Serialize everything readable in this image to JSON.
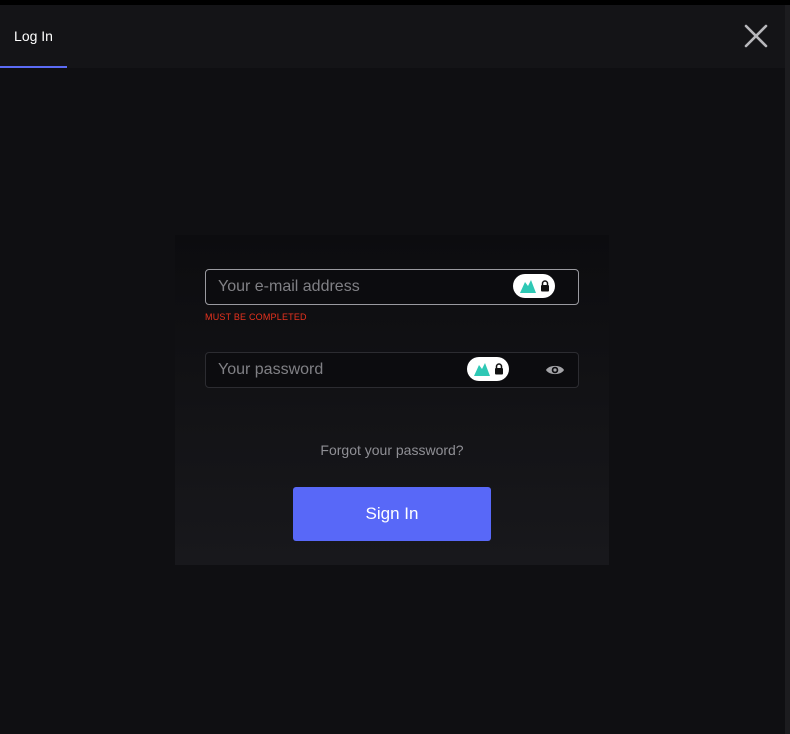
{
  "header": {
    "tab_label": "Log In"
  },
  "form": {
    "email": {
      "placeholder": "Your e-mail address",
      "value": "",
      "error": "MUST BE COMPLETED"
    },
    "password": {
      "placeholder": "Your password",
      "value": ""
    },
    "forgot_label": "Forgot your password?",
    "submit_label": "Sign In"
  },
  "icons": {
    "close": "close-icon",
    "password_manager": "nordpass-icon",
    "lock": "lock-icon",
    "show_password": "eye-icon"
  },
  "colors": {
    "accent": "#5868f8",
    "tab_underline": "#5b6bf5",
    "error": "#e8321e",
    "background": "#0f0f12",
    "badge_teal": "#2ec8b5"
  }
}
